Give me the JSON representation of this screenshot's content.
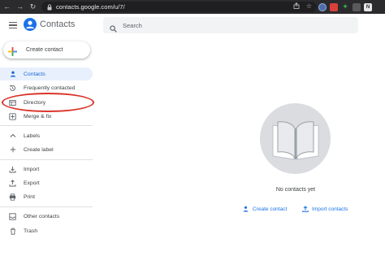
{
  "browser": {
    "url": "contacts.google.com/u/7/",
    "extensions": [
      {
        "name": "profile-extension-icon",
        "label": "",
        "color": "#4a6db0"
      },
      {
        "name": "red-extension-icon",
        "label": "",
        "color": "#d9403a"
      },
      {
        "name": "evernote-extension-icon",
        "label": "",
        "color": "#33b24a"
      },
      {
        "name": "dark-extension-icon",
        "label": "",
        "color": "#5a5a5e"
      },
      {
        "name": "n-extension-icon",
        "label": "N",
        "color": "#e6e6e6"
      }
    ]
  },
  "header": {
    "title": "Contacts",
    "brand_color": "#1a73e8",
    "search_placeholder": "Search"
  },
  "sidebar": {
    "create_label": "Create contact",
    "items": [
      {
        "label": "Contacts",
        "icon": "person-icon",
        "active": true
      },
      {
        "label": "Frequently contacted",
        "icon": "history-icon",
        "active": false
      },
      {
        "label": "Directory",
        "icon": "directory-icon",
        "active": false
      },
      {
        "label": "Merge & fix",
        "icon": "merge-icon",
        "active": false
      }
    ],
    "labels_header": "Labels",
    "create_label_item": "Create label",
    "tools": [
      {
        "label": "Import",
        "icon": "import-icon"
      },
      {
        "label": "Export",
        "icon": "export-icon"
      },
      {
        "label": "Print",
        "icon": "print-icon"
      }
    ],
    "more": [
      {
        "label": "Other contacts",
        "icon": "other-contacts-icon"
      },
      {
        "label": "Trash",
        "icon": "trash-icon"
      }
    ],
    "highlight_color": "#d9362b"
  },
  "main": {
    "empty_text": "No contacts yet",
    "create_contact": "Create contact",
    "import_contacts": "Import contacts",
    "accent_color": "#1a73e8"
  }
}
